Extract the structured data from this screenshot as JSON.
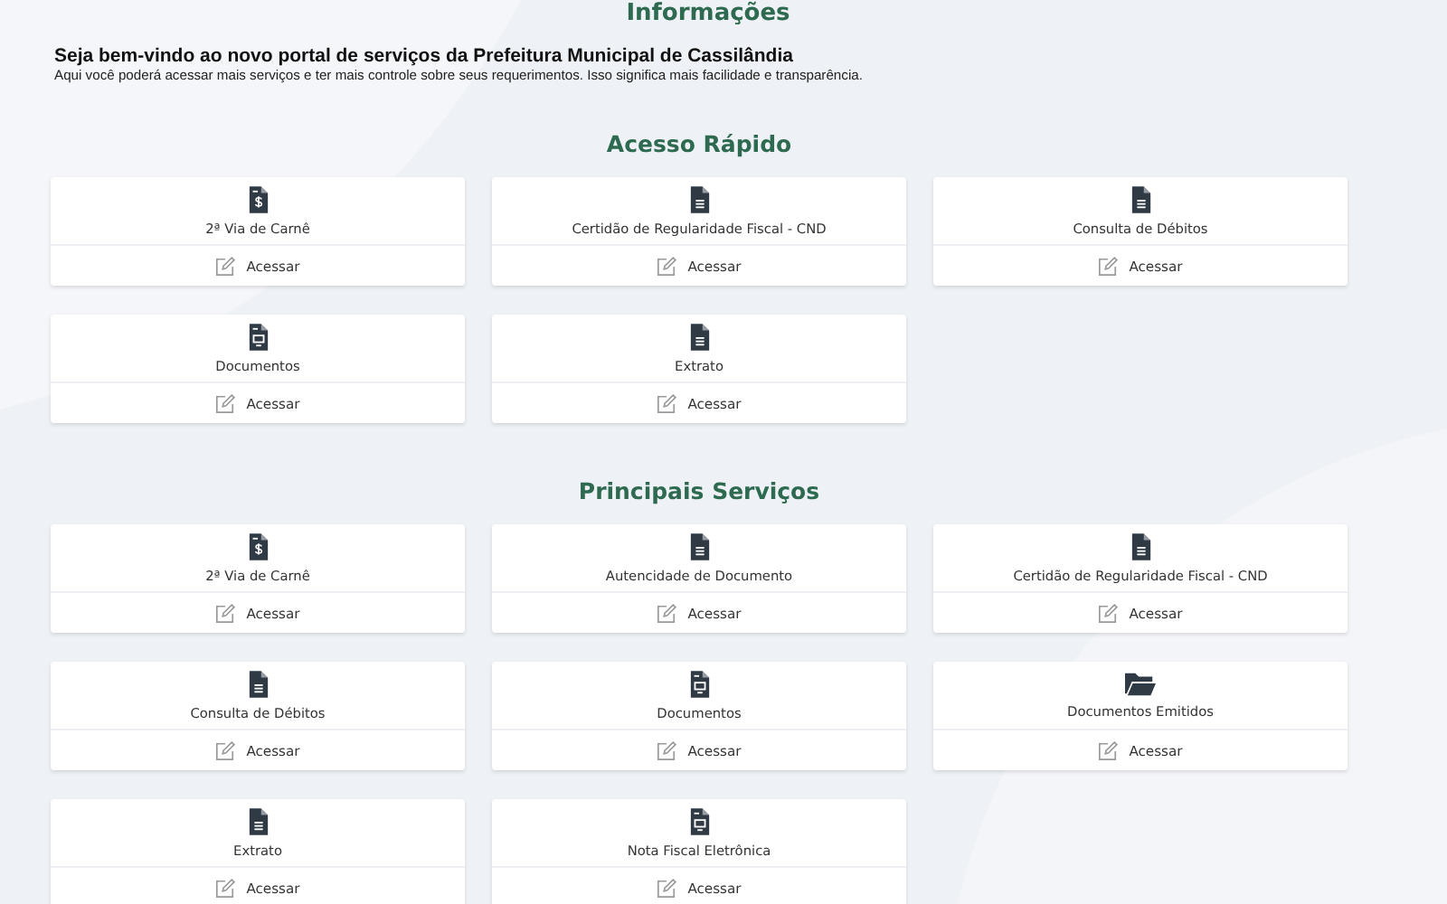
{
  "info": {
    "title": "Informações",
    "welcome": "Seja bem-vindo ao novo portal de serviços da Prefeitura Municipal de Cassilândia",
    "description": "Aqui você poderá acessar mais serviços e ter mais controle sobre seus requerimentos. Isso significa mais facilidade e transparência."
  },
  "sections": [
    {
      "title": "Acesso Rápido",
      "cards": [
        {
          "kind": "money",
          "label": "2ª Via de Carnê",
          "action": "Acessar"
        },
        {
          "kind": "lines",
          "label": "Certidão de Regularidade Fiscal - CND",
          "action": "Acessar"
        },
        {
          "kind": "lines",
          "label": "Consulta de Débitos",
          "action": "Acessar"
        },
        {
          "kind": "print",
          "label": "Documentos",
          "action": "Acessar"
        },
        {
          "kind": "lines",
          "label": "Extrato",
          "action": "Acessar"
        }
      ]
    },
    {
      "title": "Principais Serviços",
      "cards": [
        {
          "kind": "money",
          "label": "2ª Via de Carnê",
          "action": "Acessar"
        },
        {
          "kind": "lines",
          "label": "Autencidade de Documento",
          "action": "Acessar"
        },
        {
          "kind": "lines",
          "label": "Certidão de Regularidade Fiscal - CND",
          "action": "Acessar"
        },
        {
          "kind": "lines",
          "label": "Consulta de Débitos",
          "action": "Acessar"
        },
        {
          "kind": "print",
          "label": "Documentos",
          "action": "Acessar"
        },
        {
          "kind": "folder",
          "label": "Documentos Emitidos",
          "action": "Acessar"
        },
        {
          "kind": "lines",
          "label": "Extrato",
          "action": "Acessar"
        },
        {
          "kind": "print",
          "label": "Nota Fiscal Eletrônica",
          "action": "Acessar"
        }
      ]
    }
  ]
}
